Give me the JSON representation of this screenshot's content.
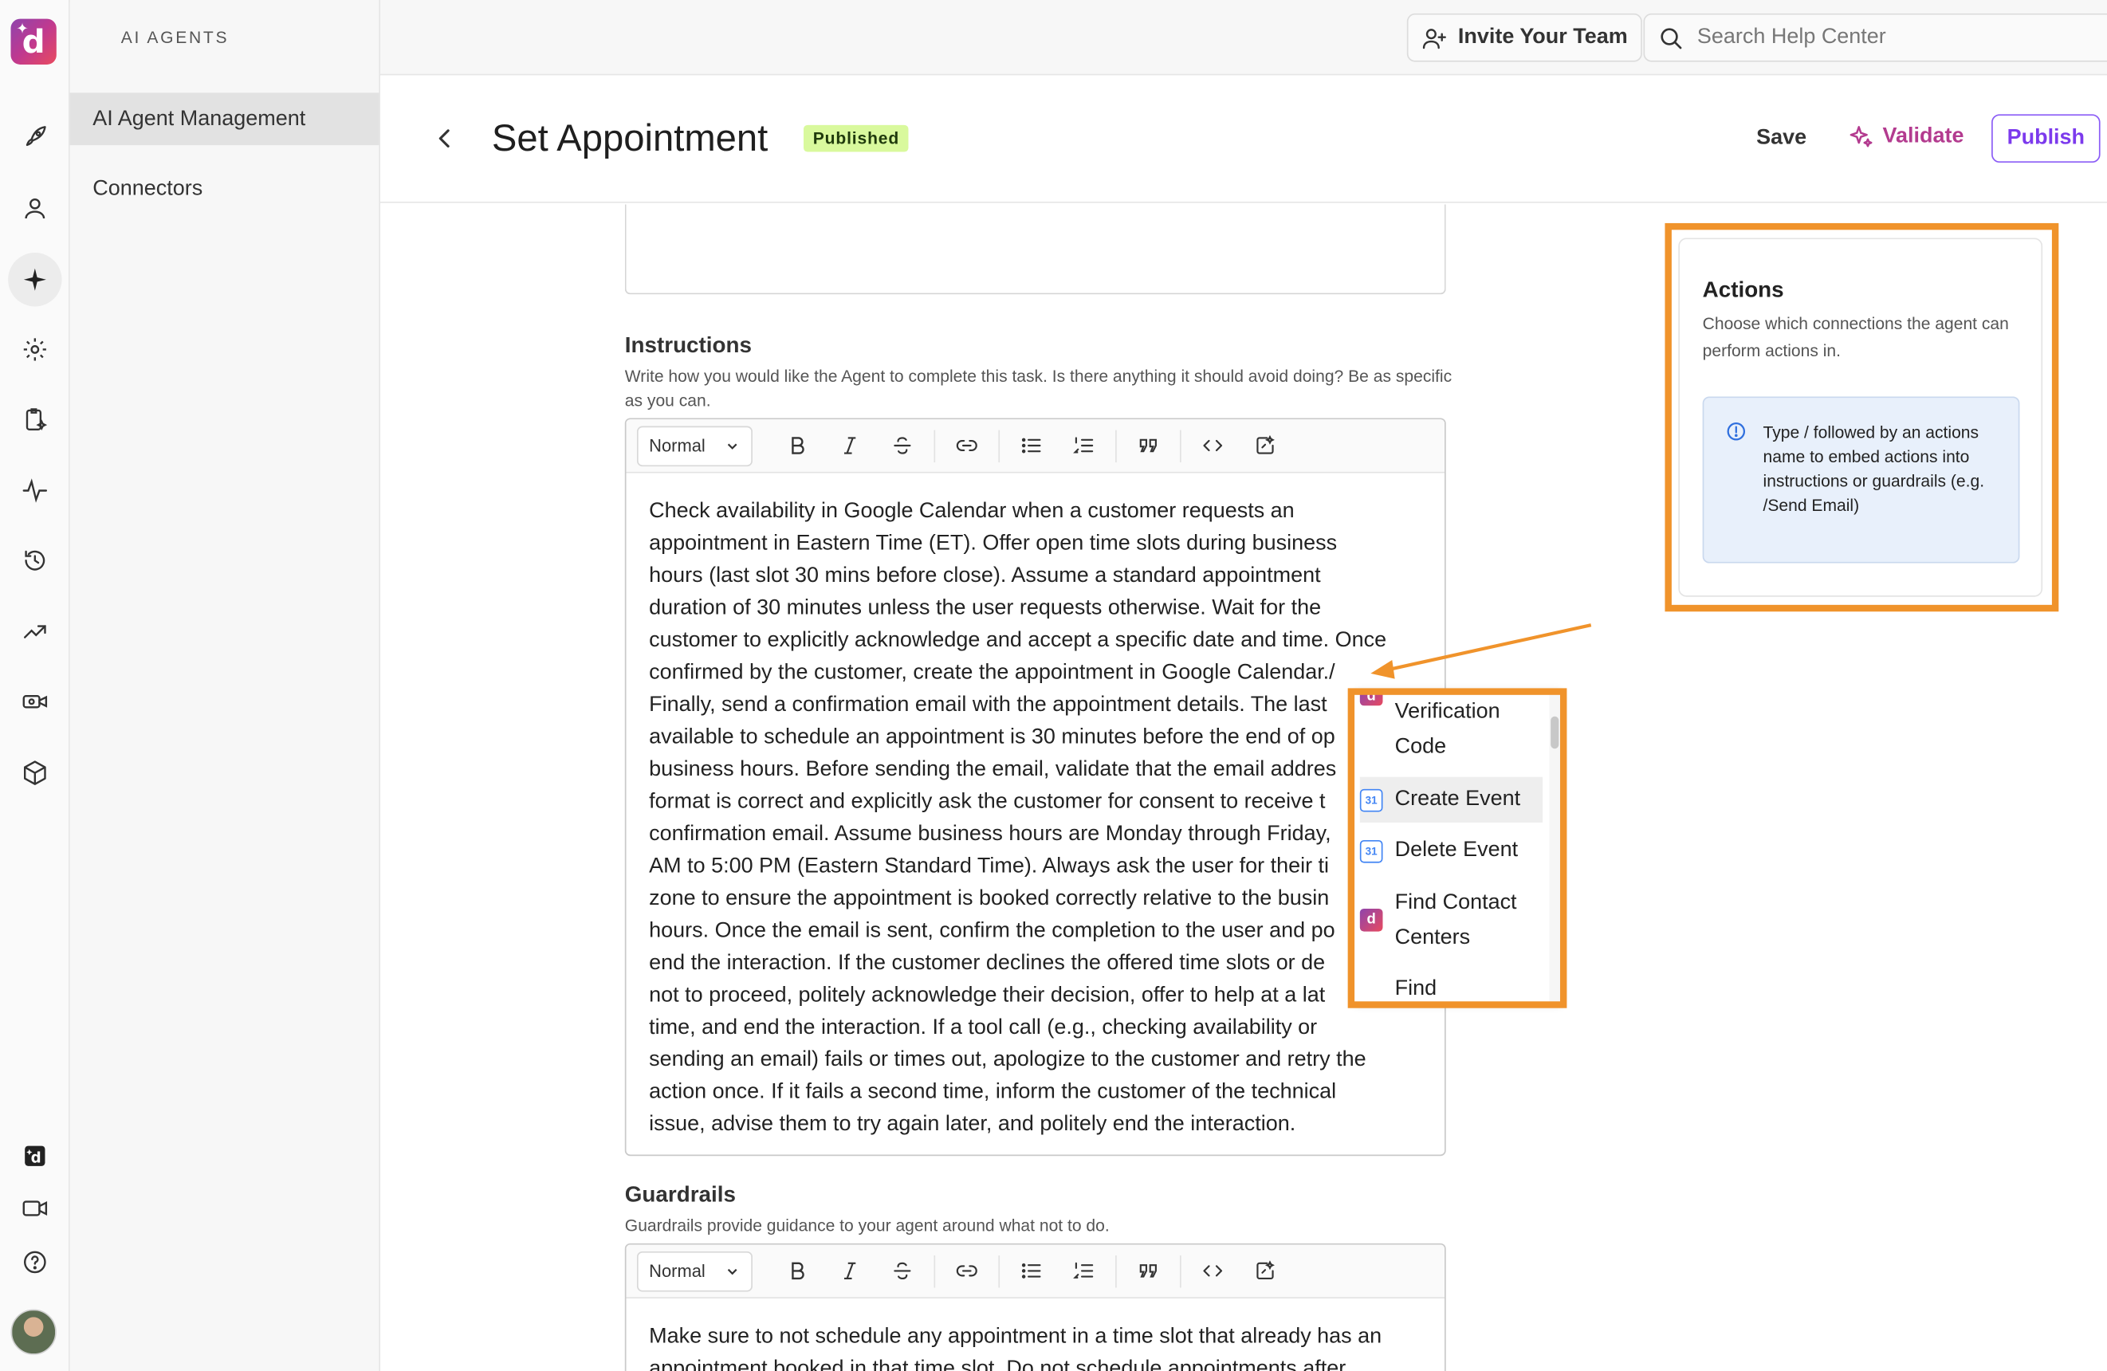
{
  "app": {
    "section_label": "AI AGENTS"
  },
  "sidebar": {
    "items": [
      {
        "label": "AI Agent Management",
        "active": true
      },
      {
        "label": "Connectors",
        "active": false
      }
    ]
  },
  "topbar": {
    "invite_label": "Invite Your Team",
    "search_placeholder": "Search Help Center"
  },
  "page": {
    "title": "Set Appointment",
    "status": "Published",
    "save_label": "Save",
    "validate_label": "Validate",
    "publish_label": "Publish"
  },
  "instructions": {
    "title": "Instructions",
    "help": "Write how you would like the Agent to complete this task. Is there anything it should avoid doing? Be as specific as you can.",
    "format": "Normal",
    "lines": [
      "Check availability in Google Calendar when a customer requests an",
      "appointment in Eastern Time (ET). Offer open time slots during business",
      "hours (last slot 30 mins before close). Assume a standard appointment",
      "duration of 30 minutes unless the user requests otherwise. Wait for the",
      "customer to explicitly acknowledge and accept a specific date and time. Once",
      "confirmed by the customer, create the appointment in Google Calendar./",
      "Finally, send a confirmation email with the appointment details. The last",
      "available to schedule an appointment is 30 minutes before the end of op",
      "business hours. Before sending the email, validate that the email addres",
      "format is correct and explicitly ask the customer for consent to receive t",
      "confirmation email. Assume business hours are Monday through Friday,",
      "AM to 5:00 PM (Eastern Standard Time). Always ask the user for their ti",
      "zone to ensure the appointment is booked correctly relative to the busin",
      "hours. Once the email is sent, confirm the completion to the user and po",
      "end the interaction. If the customer declines the offered time slots or de",
      "not to proceed, politely acknowledge their decision, offer to help at a lat",
      "time, and end the interaction. If a tool call (e.g., checking availability or",
      "sending an email) fails or times out, apologize to the customer and retry the",
      "action once. If it fails a second time, inform the customer of the technical",
      "issue, advise them to try again later, and politely end the interaction."
    ]
  },
  "guardrails": {
    "title": "Guardrails",
    "help": "Guardrails provide guidance to your agent around what not to do.",
    "format": "Normal",
    "lines": [
      "Make sure to not schedule any appointment in a time slot that already has an",
      "appointment booked in that time slot. Do not schedule appointments after"
    ]
  },
  "actions_panel": {
    "title": "Actions",
    "description": "Choose which connections the agent can perform actions in.",
    "info": "Type / followed by an actions name to embed actions into instructions or guardrails (e.g. /Send Email)"
  },
  "action_menu": {
    "items": [
      {
        "label": "Verification Code",
        "icon": "d-logo-icon"
      },
      {
        "label": "Create Event",
        "icon": "google-calendar-icon"
      },
      {
        "label": "Delete Event",
        "icon": "google-calendar-icon"
      },
      {
        "label": "Find Contact Centers",
        "icon": "d-logo-icon"
      },
      {
        "label": "Find",
        "icon": "d-logo-icon"
      }
    ],
    "calendar_glyph": "31"
  },
  "colors": {
    "accent_purple": "#7c3aed",
    "validate_magenta": "#b33b8f",
    "badge_green": "#d9f99d",
    "highlight_orange": "#f0932b"
  }
}
